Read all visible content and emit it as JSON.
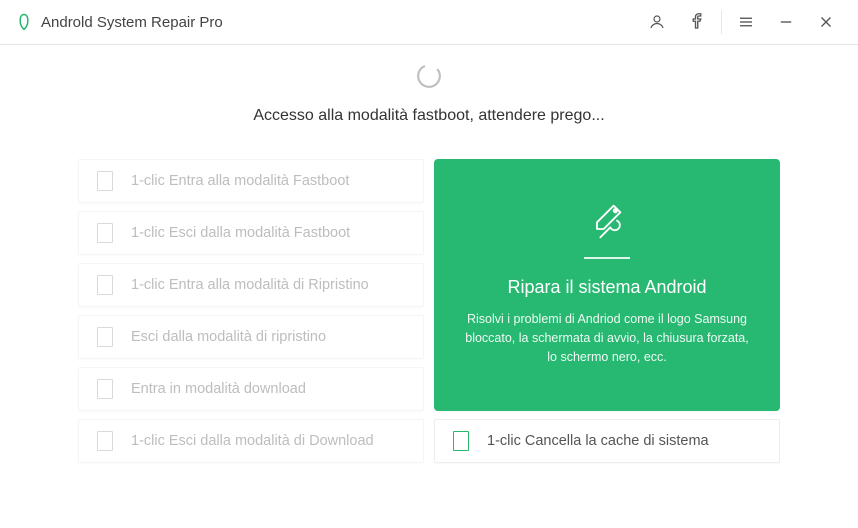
{
  "app": {
    "title": "Androld System Repair Pro"
  },
  "loading": {
    "text": "Accesso alla modalità fastboot, attendere prego..."
  },
  "left_cards": [
    {
      "label": "1-clic Entra alla modalità Fastboot"
    },
    {
      "label": "1-clic Esci dalla modalità Fastboot"
    },
    {
      "label": "1-clic Entra alla modalità di Ripristino"
    },
    {
      "label": "Esci dalla modalità di ripristino"
    },
    {
      "label": "Entra in modalità download"
    },
    {
      "label": "1-clic Esci dalla modalità di Download"
    }
  ],
  "feature": {
    "title": "Ripara il sistema Android",
    "desc": "Risolvi i problemi di Andriod come il logo Samsung bloccato, la schermata di avvio, la chiusura forzata, lo schermo nero, ecc."
  },
  "clear_cache": {
    "label": "1-clic Cancella la cache di sistema"
  }
}
